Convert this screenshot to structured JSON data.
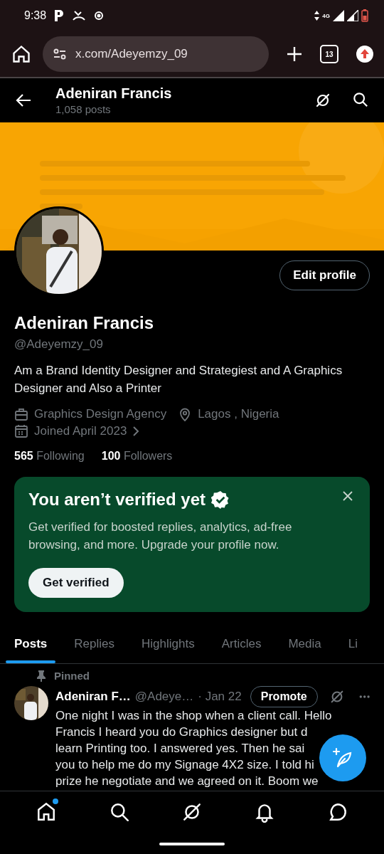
{
  "status_bar": {
    "time": "9:38",
    "network": "4G"
  },
  "browser": {
    "url": "x.com/Adeyemzy_09",
    "tab_count": "13"
  },
  "header": {
    "title": "Adeniran Francis",
    "subtitle": "1,058 posts"
  },
  "profile": {
    "edit_button": "Edit profile",
    "name": "Adeniran Francis",
    "handle": "@Adeyemzy_09",
    "bio": "Am a Brand Identity Designer and Strategiest and A Graphics Designer and Also a Printer",
    "meta": [
      {
        "kind": "work",
        "text": "Graphics Design Agency"
      },
      {
        "kind": "location",
        "text": "Lagos , Nigeria"
      },
      {
        "kind": "joined",
        "text": "Joined April 2023"
      }
    ],
    "stats": [
      {
        "count": "565",
        "label": "Following"
      },
      {
        "count": "100",
        "label": "Followers"
      }
    ]
  },
  "verify_card": {
    "title": "You aren’t verified yet",
    "text": "Get verified for boosted replies, analytics, ad-free browsing, and more. Upgrade your profile now.",
    "button": "Get verified"
  },
  "tabs": [
    {
      "label": "Posts",
      "selected": true
    },
    {
      "label": "Replies",
      "selected": false
    },
    {
      "label": "Highlights",
      "selected": false
    },
    {
      "label": "Articles",
      "selected": false
    },
    {
      "label": "Media",
      "selected": false
    },
    {
      "label": "Li",
      "selected": false
    }
  ],
  "post": {
    "pinned_label": "Pinned",
    "author": "Adeniran F…",
    "handle": "@Adeye…",
    "date": "· Jan 22",
    "promote": "Promote",
    "lines": [
      "One night I was in the shop when a client call. Hello",
      "Francis I heard you do Graphics designer but d",
      "learn Printing too. I answered yes. Then he sai",
      "you to help me do my Signage 4X2 size. I told hi",
      "prize he negotiate and we agreed on it. Boom we"
    ]
  },
  "bottom_nav": [
    {
      "kind": "home",
      "badge": true
    },
    {
      "kind": "search",
      "badge": false
    },
    {
      "kind": "grok",
      "badge": false
    },
    {
      "kind": "notifications",
      "badge": false
    },
    {
      "kind": "messages",
      "badge": false
    }
  ]
}
